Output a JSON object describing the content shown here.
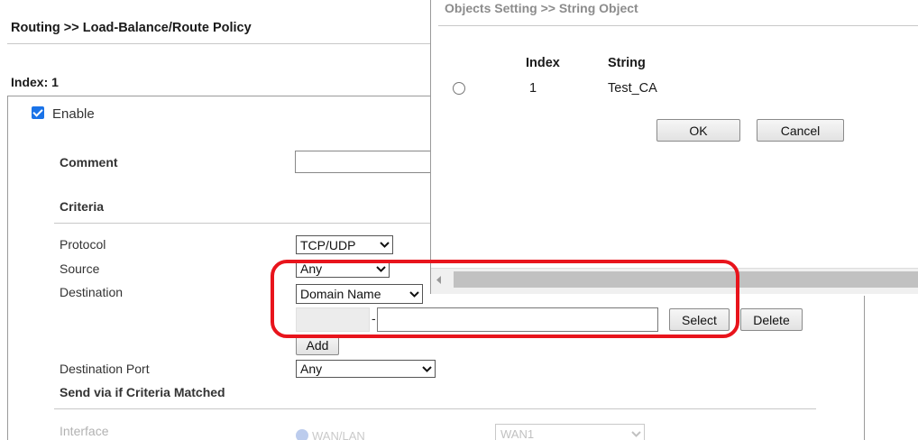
{
  "main": {
    "breadcrumb": "Routing >> Load-Balance/Route Policy",
    "index_label": "Index: 1",
    "enable_label": "Enable",
    "enable_checked": true,
    "comment_label": "Comment",
    "comment_value": "",
    "criteria_label": "Criteria",
    "protocol": {
      "label": "Protocol",
      "value": "TCP/UDP"
    },
    "source": {
      "label": "Source",
      "value": "Any"
    },
    "destination": {
      "label": "Destination",
      "value": "Domain Name",
      "start_value": "",
      "end_value": "",
      "separator": "-",
      "select_label": "Select",
      "delete_label": "Delete",
      "add_label": "Add"
    },
    "destination_port": {
      "label": "Destination Port",
      "value": "Any"
    },
    "send_via_label": "Send via if Criteria Matched",
    "interface": {
      "label": "Interface",
      "option_label": "WAN/LAN",
      "value": "WAN1"
    }
  },
  "popup": {
    "title": "Objects Setting >> String Object",
    "columns": {
      "index": "Index",
      "string": "String"
    },
    "rows": [
      {
        "index": "1",
        "string": "Test_CA"
      }
    ],
    "ok_label": "OK",
    "cancel_label": "Cancel"
  },
  "icons": {
    "chevron": "chevron-down-icon",
    "scroll_left": "scroll-left-arrow-icon"
  },
  "colors": {
    "highlight": "#e8141c",
    "checkbox": "#1a73e8"
  }
}
